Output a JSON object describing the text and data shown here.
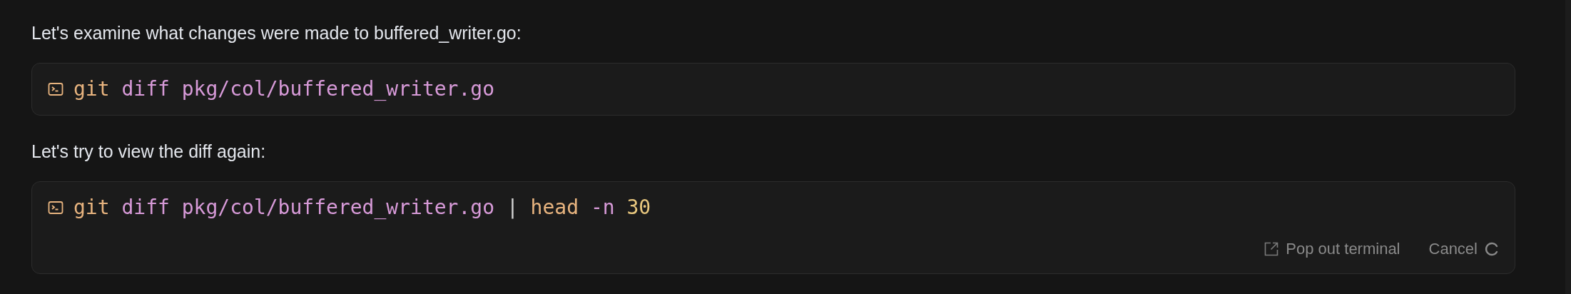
{
  "items": [
    {
      "kind": "text",
      "text": "Let's examine what changes were made to buffered_writer.go:"
    },
    {
      "kind": "command",
      "tokens": [
        {
          "text": "git",
          "kind": "command"
        },
        {
          "text": "diff",
          "kind": "arg"
        },
        {
          "text": "pkg/col/buffered_writer.go",
          "kind": "arg"
        }
      ]
    },
    {
      "kind": "text",
      "text": "Let's try to view the diff again:"
    },
    {
      "kind": "command",
      "tokens": [
        {
          "text": "git",
          "kind": "command"
        },
        {
          "text": "diff",
          "kind": "arg"
        },
        {
          "text": "pkg/col/buffered_writer.go",
          "kind": "arg"
        },
        {
          "text": "|",
          "kind": "operator"
        },
        {
          "text": "head",
          "kind": "command"
        },
        {
          "text": "-n",
          "kind": "arg"
        },
        {
          "text": "30",
          "kind": "number"
        }
      ],
      "actions": [
        {
          "label": "Pop out terminal",
          "kind": "popout"
        },
        {
          "label": "Cancel",
          "kind": "cancel",
          "running": true
        }
      ]
    }
  ]
}
